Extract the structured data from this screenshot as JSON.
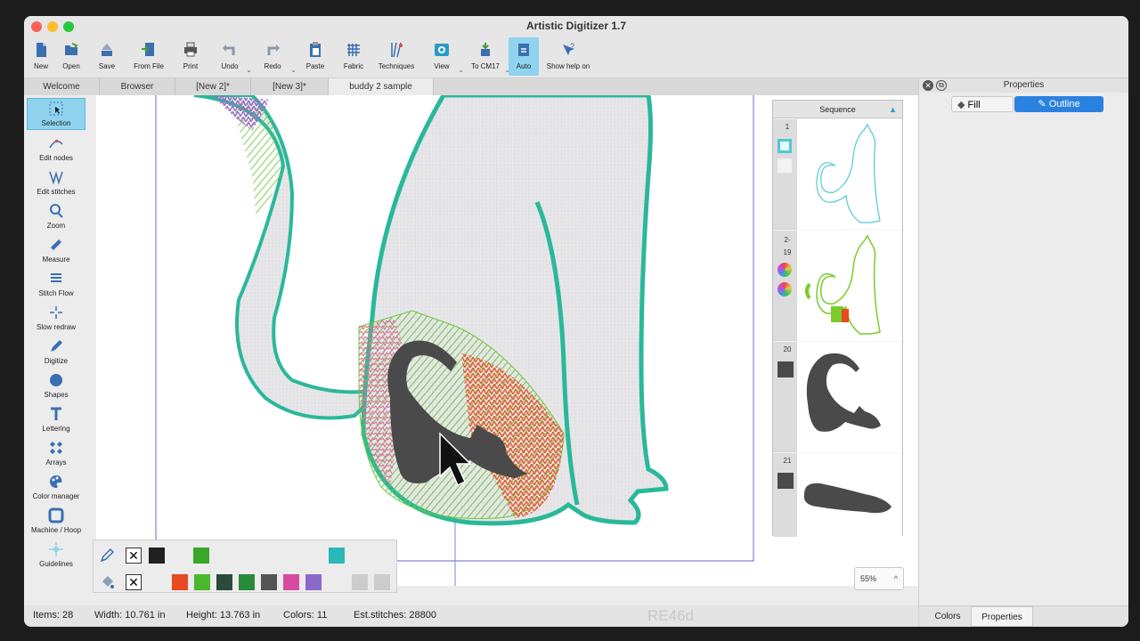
{
  "window": {
    "title": "Artistic Digitizer 1.7"
  },
  "toolbar": {
    "buttons": [
      {
        "label": "New",
        "icon": "new-file-icon"
      },
      {
        "label": "Open",
        "icon": "open-folder-icon"
      },
      {
        "label": "Save",
        "icon": "save-icon"
      },
      {
        "label": "From File",
        "icon": "from-file-icon"
      },
      {
        "label": "Print",
        "icon": "print-icon"
      },
      {
        "label": "Undo",
        "icon": "undo-icon"
      },
      {
        "label": "Redo",
        "icon": "redo-icon"
      },
      {
        "label": "Paste",
        "icon": "paste-icon"
      },
      {
        "label": "Fabric",
        "icon": "fabric-icon"
      },
      {
        "label": "Techniques",
        "icon": "techniques-icon"
      },
      {
        "label": "View",
        "icon": "view-eye-icon"
      },
      {
        "label": "To CM17",
        "icon": "to-cm17-icon"
      },
      {
        "label": "Auto",
        "icon": "auto-icon"
      },
      {
        "label": "Show help on",
        "icon": "help-icon"
      }
    ]
  },
  "tabs": [
    "Welcome",
    "Browser",
    "[New 2]*",
    "[New 3]*",
    "buddy 2 sample"
  ],
  "left_tools": [
    {
      "label": "Selection",
      "icon": "selection-icon"
    },
    {
      "label": "Edit nodes",
      "icon": "edit-nodes-icon"
    },
    {
      "label": "Edit stitches",
      "icon": "edit-stitches-icon"
    },
    {
      "label": "Zoom",
      "icon": "zoom-icon"
    },
    {
      "label": "Measure",
      "icon": "measure-icon"
    },
    {
      "label": "Stitch Flow",
      "icon": "stitch-flow-icon"
    },
    {
      "label": "Slow redraw",
      "icon": "slow-redraw-icon"
    },
    {
      "label": "Digitize",
      "icon": "digitize-icon"
    },
    {
      "label": "Shapes",
      "icon": "shapes-icon"
    },
    {
      "label": "Lettering",
      "icon": "lettering-icon"
    },
    {
      "label": "Arrays",
      "icon": "arrays-icon"
    },
    {
      "label": "Color manager",
      "icon": "color-manager-icon"
    },
    {
      "label": "Machine / Hoop",
      "icon": "machine-hoop-icon"
    },
    {
      "label": "Guidelines",
      "icon": "guidelines-icon"
    }
  ],
  "sequence": {
    "title": "Sequence",
    "items": [
      {
        "num": "1",
        "color": "#4fc8d8"
      },
      {
        "num": "2-\n19",
        "color": "#7acc2a"
      },
      {
        "num": "20",
        "color": "#4a4a4a"
      },
      {
        "num": "21",
        "color": "#4a4a4a"
      }
    ]
  },
  "status": {
    "items": "Items: 28",
    "width": "Width: 10.761 in",
    "height": "Height: 13.763 in",
    "colors": "Colors: 11",
    "stitches": "Est.stitches: 28800",
    "watermark": "RE46d"
  },
  "zoom": {
    "level": "55%"
  },
  "properties": {
    "title": "Properties",
    "fill_label": "Fill",
    "outline_label": "Outline",
    "footer_tabs": [
      "Colors",
      "Properties"
    ]
  },
  "palette": {
    "outline_swatches": [
      "#202020",
      "#3aa62a",
      "#2ab8b8"
    ],
    "fill_swatches": [
      "#e84a22",
      "#4ab82a",
      "#2a4a3a",
      "#2a8a3a",
      "#555555",
      "#d84aa0",
      "#8a6ac8",
      "#cccccc",
      "#cccccc"
    ]
  }
}
